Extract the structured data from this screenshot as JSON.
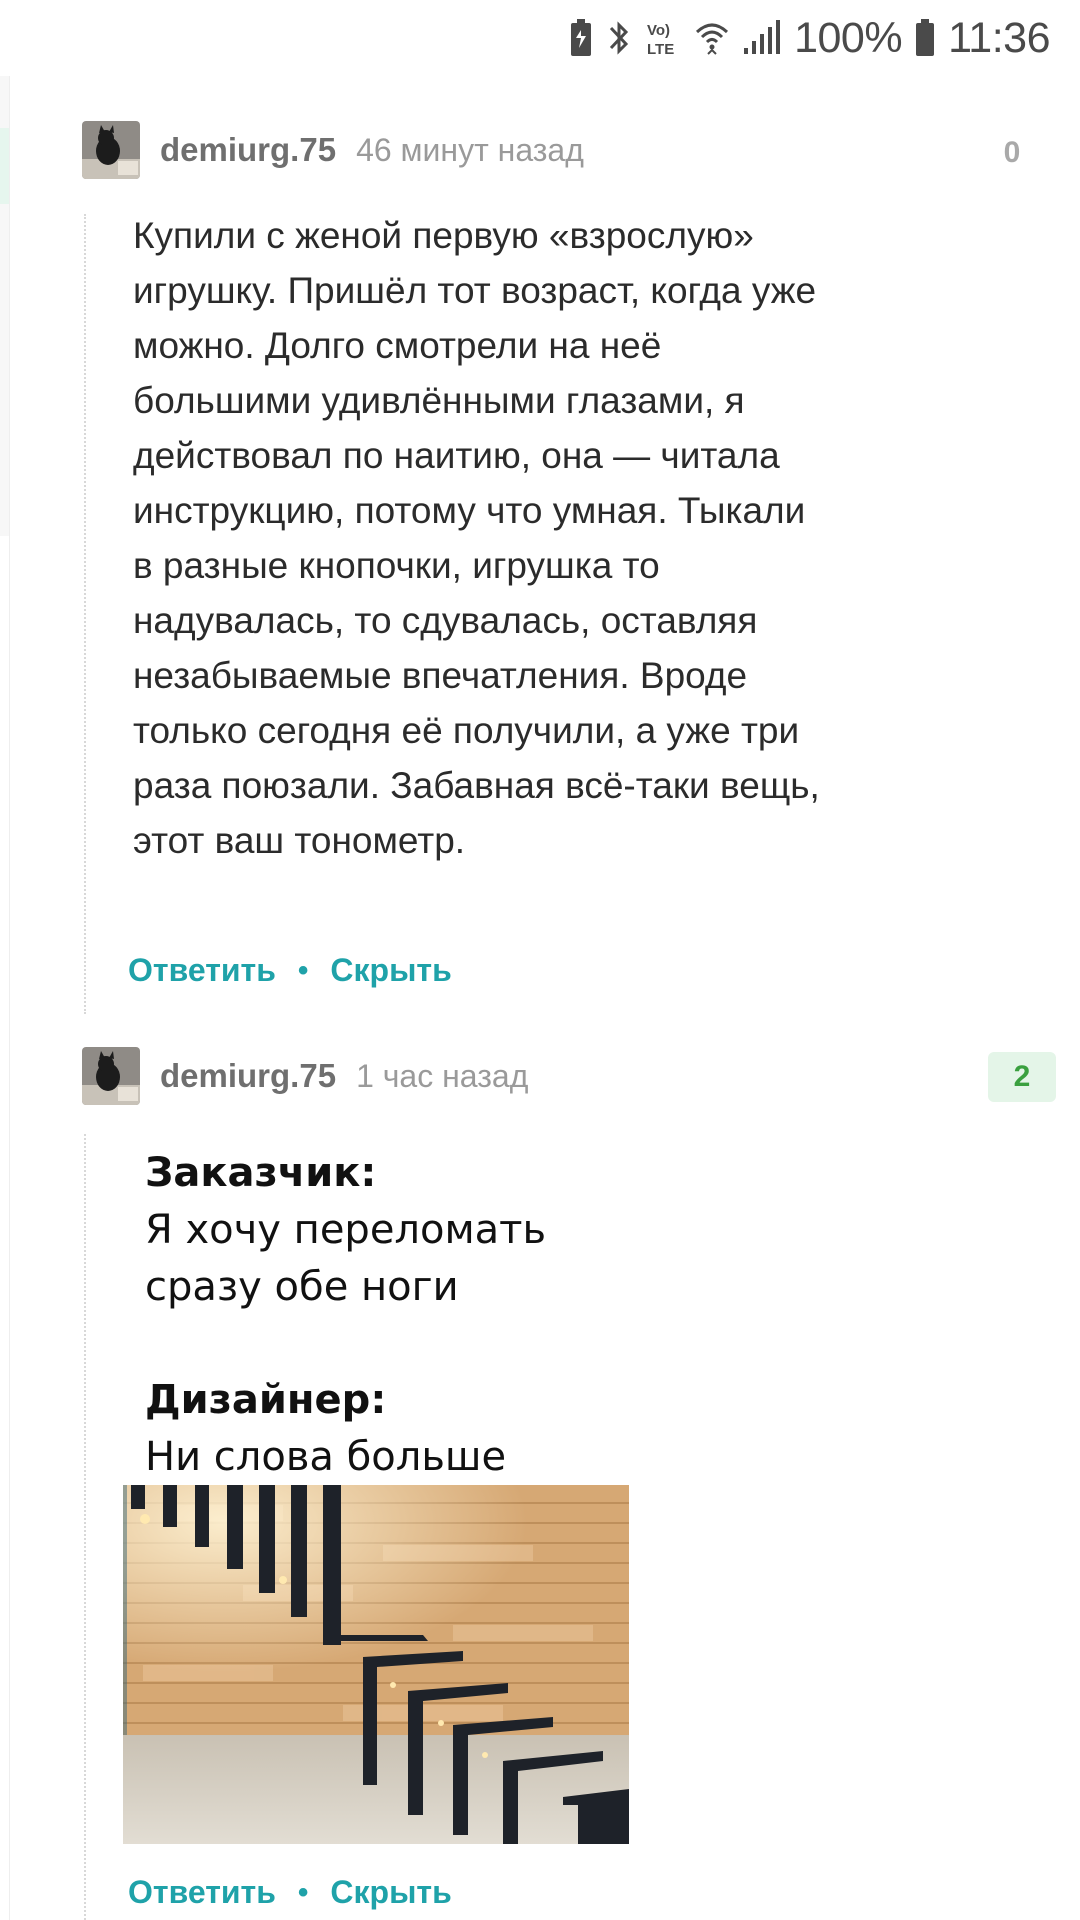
{
  "status_bar": {
    "battery_percent": "100%",
    "time": "11:36",
    "icons": [
      "battery-saver-icon",
      "bluetooth-icon",
      "volte-icon",
      "wifi-icon",
      "signal-icon",
      "battery-icon"
    ]
  },
  "comments": [
    {
      "username": "demiurg.75",
      "timestamp": "46 минут назад",
      "rating": "0",
      "text": "Купили с женой первую «взрослую» игрушку. Пришёл тот возраст, когда уже можно. Долго смотрели на неё большими удивлёнными глазами, я действовал по наитию, она — читала инструкцию, потому что умная. Тыкали в разные кнопочки, игрушка то надувалась, то сдувалась, оставляя незабываемые впечатления. Вроде только сегодня её получили, а уже три раза поюзали. Забавная всё-таки вещь, этот ваш тонометр.",
      "reply_label": "Ответить",
      "hide_label": "Скрыть"
    },
    {
      "username": "demiurg.75",
      "timestamp": "1 час назад",
      "rating": "2",
      "image": {
        "label_1": "Заказчик:",
        "line_1a": "Я хочу переломать",
        "line_1b": "сразу обе ноги",
        "label_2": "Дизайнер:",
        "line_2a": "Ни слова больше",
        "photo": "floating-staircase-photo"
      },
      "reply_label": "Ответить",
      "hide_label": "Скрыть"
    }
  ],
  "colors": {
    "accent": "#1fa2a9",
    "rating_positive": "#3aa03f",
    "rating_positive_bg": "#e4f5e8"
  }
}
